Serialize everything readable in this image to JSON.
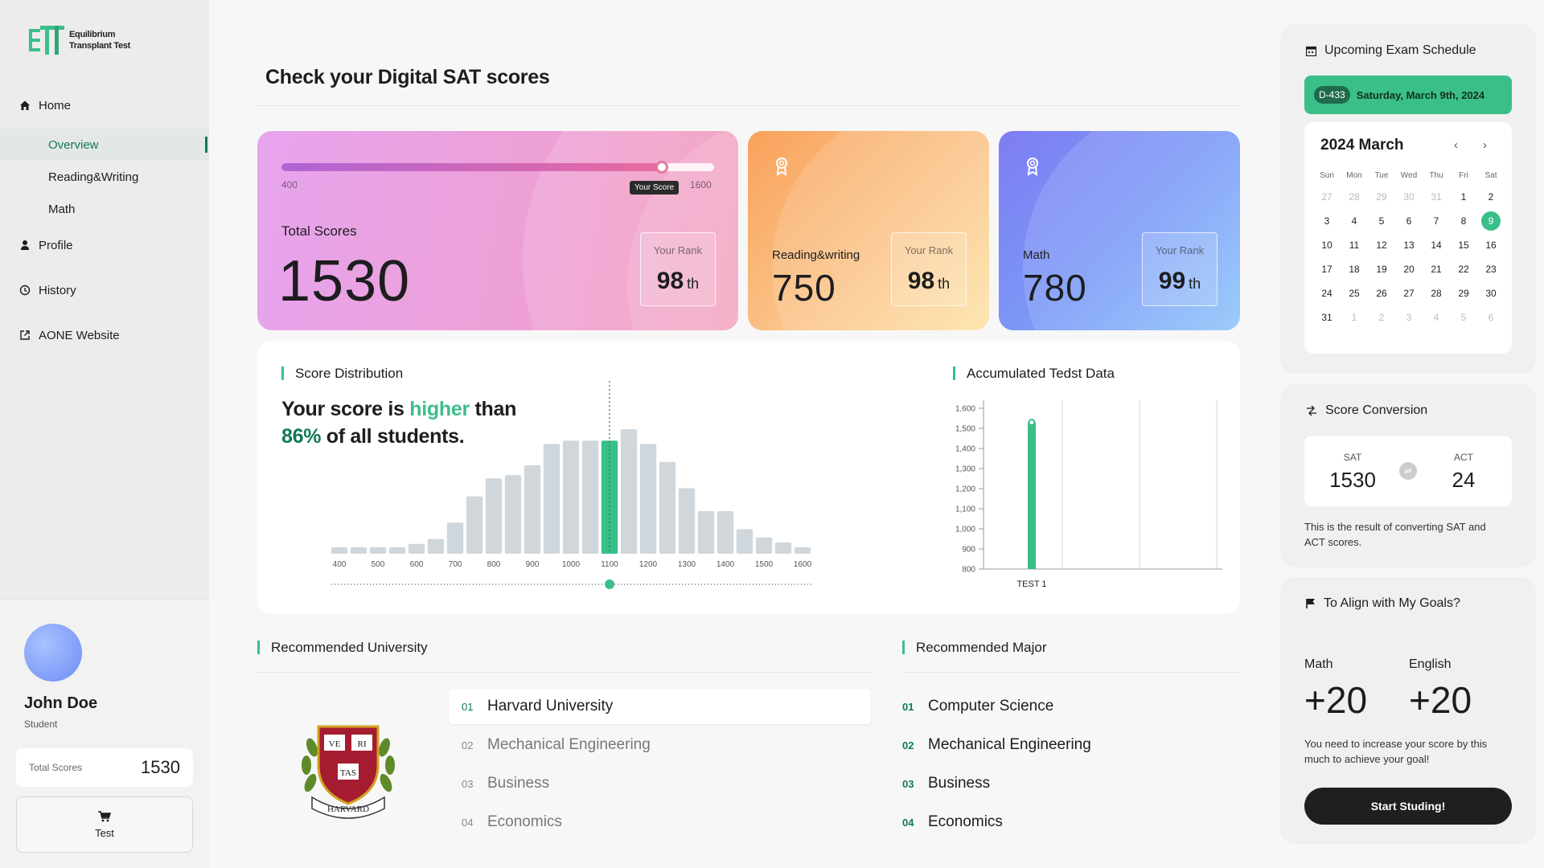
{
  "app": {
    "logo_line1": "Equilibrium",
    "logo_line2": "Transplant Test"
  },
  "sidebar": {
    "home": "Home",
    "sub_items": [
      "Overview",
      "Reading&Writing",
      "Math"
    ],
    "profile": "Profile",
    "history": "History",
    "website": "AONE Website",
    "user_name": "John Doe",
    "user_role": "Student",
    "total_label": "Total Scores",
    "total_value": "1530",
    "test_button": "Test"
  },
  "main": {
    "title": "Check your Digital SAT scores"
  },
  "total_card": {
    "progress_min": "400",
    "progress_max": "1600",
    "progress_fraction": 0.88,
    "tooltip": "Your Score",
    "label": "Total Scores",
    "score": "1530",
    "rank_label": "Your Rank",
    "rank_value": "98",
    "rank_suffix": "th"
  },
  "rw_card": {
    "label": "Reading&writing",
    "score": "750",
    "rank_label": "Your Rank",
    "rank_value": "98",
    "rank_suffix": "th"
  },
  "math_card": {
    "label": "Math",
    "score": "780",
    "rank_label": "Your Rank",
    "rank_value": "99",
    "rank_suffix": "th"
  },
  "distribution": {
    "title": "Score Distribution",
    "headline_1": "Your score is ",
    "headline_hl": "higher",
    "headline_2": " than",
    "headline_pct": "86%",
    "headline_3": " of all students."
  },
  "accumulated": {
    "title": "Accumulated Tedst Data"
  },
  "chart_data": [
    {
      "type": "bar",
      "title": "Score Distribution",
      "x_ticks": [
        "400",
        "500",
        "600",
        "700",
        "800",
        "900",
        "1000",
        "1100",
        "1200",
        "1300",
        "1400",
        "1500",
        "1600"
      ],
      "values": [
        4,
        4,
        4,
        4,
        6,
        9,
        19,
        35,
        46,
        48,
        54,
        67,
        69,
        69,
        69,
        76,
        67,
        56,
        40,
        26,
        26,
        15,
        10,
        7,
        4
      ],
      "highlight_index": 14,
      "highlight_label": "1100",
      "grid": false
    },
    {
      "type": "bar",
      "title": "Accumulated Tedst Data",
      "categories": [
        "TEST 1"
      ],
      "values": [
        1530
      ],
      "y_ticks": [
        "1,600",
        "1,500",
        "1,400",
        "1,300",
        "1,200",
        "1,100",
        "1,000",
        "900",
        "800"
      ],
      "ylim": [
        800,
        1600
      ]
    }
  ],
  "recommended": {
    "university_title": "Recommended University",
    "universities": [
      {
        "num": "01",
        "name": "Harvard University"
      },
      {
        "num": "02",
        "name": "Mechanical Engineering"
      },
      {
        "num": "03",
        "name": "Business"
      },
      {
        "num": "04",
        "name": "Economics"
      }
    ],
    "major_title": "Recommended Major",
    "majors": [
      {
        "num": "01",
        "name": "Computer Science"
      },
      {
        "num": "02",
        "name": "Mechanical Engineering"
      },
      {
        "num": "03",
        "name": "Business"
      },
      {
        "num": "04",
        "name": "Economics"
      }
    ],
    "crest_text": [
      "VE",
      "RI",
      "TAS",
      "HARVARD"
    ]
  },
  "schedule": {
    "title": "Upcoming Exam Schedule",
    "d_day": "D-433",
    "date": "Saturday, March 9th, 2024",
    "cal_title": "2024 March",
    "weekdays": [
      "Sun",
      "Mon",
      "Tue",
      "Wed",
      "Thu",
      "Fri",
      "Sat"
    ],
    "days": [
      "27",
      "28",
      "29",
      "30",
      "31",
      "1",
      "2",
      "3",
      "4",
      "5",
      "6",
      "7",
      "8",
      "9",
      "10",
      "11",
      "12",
      "13",
      "14",
      "15",
      "16",
      "17",
      "18",
      "19",
      "20",
      "21",
      "22",
      "23",
      "24",
      "25",
      "26",
      "27",
      "28",
      "29",
      "30",
      "31",
      "1",
      "2",
      "3",
      "4",
      "5",
      "6"
    ],
    "muted_indices": [
      0,
      1,
      2,
      3,
      4,
      36,
      37,
      38,
      39,
      40,
      41
    ],
    "today_index": 13
  },
  "conversion": {
    "title": "Score Conversion",
    "sat_label": "SAT",
    "sat_value": "1530",
    "act_label": "ACT",
    "act_value": "24",
    "note": "This is the result of converting SAT and ACT scores."
  },
  "goals": {
    "title": "To Align with My Goals?",
    "math_label": "Math",
    "math_value": "+20",
    "english_label": "English",
    "english_value": "+20",
    "note": "You need to increase your score by this much to achieve your goal!",
    "button": "Start Studing!"
  },
  "colors": {
    "accent": "#3bbf89",
    "accent_dark": "#0e7a54",
    "bar_gray": "#d0d7dc"
  }
}
